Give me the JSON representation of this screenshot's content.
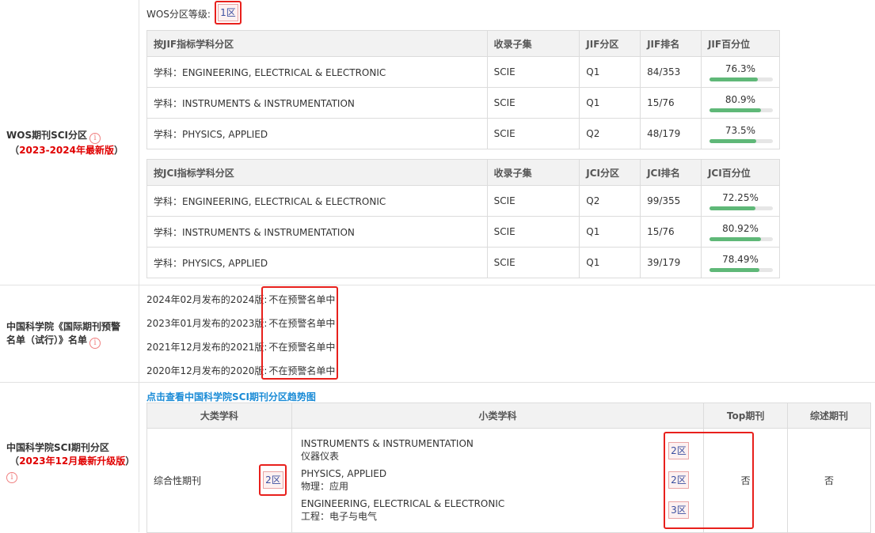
{
  "wos": {
    "grade_label": "WOS分区等级:",
    "grade_value": "1区",
    "section_label": "WOS期刊SCI分区",
    "section_note": "2023-2024年最新版",
    "jif_headers": [
      "按JIF指标学科分区",
      "收录子集",
      "JIF分区",
      "JIF排名",
      "JIF百分位"
    ],
    "jif_rows": [
      {
        "subject": "学科：ENGINEERING, ELECTRICAL & ELECTRONIC",
        "collection": "SCIE",
        "zone": "Q1",
        "rank": "84/353",
        "pct": "76.3%",
        "pct_value": 76.3
      },
      {
        "subject": "学科：INSTRUMENTS & INSTRUMENTATION",
        "collection": "SCIE",
        "zone": "Q1",
        "rank": "15/76",
        "pct": "80.9%",
        "pct_value": 80.9
      },
      {
        "subject": "学科：PHYSICS, APPLIED",
        "collection": "SCIE",
        "zone": "Q2",
        "rank": "48/179",
        "pct": "73.5%",
        "pct_value": 73.5
      }
    ],
    "jci_headers": [
      "按JCI指标学科分区",
      "收录子集",
      "JCI分区",
      "JCI排名",
      "JCI百分位"
    ],
    "jci_rows": [
      {
        "subject": "学科：ENGINEERING, ELECTRICAL & ELECTRONIC",
        "collection": "SCIE",
        "zone": "Q2",
        "rank": "99/355",
        "pct": "72.25%",
        "pct_value": 72.25
      },
      {
        "subject": "学科：INSTRUMENTS & INSTRUMENTATION",
        "collection": "SCIE",
        "zone": "Q1",
        "rank": "15/76",
        "pct": "80.92%",
        "pct_value": 80.92
      },
      {
        "subject": "学科：PHYSICS, APPLIED",
        "collection": "SCIE",
        "zone": "Q1",
        "rank": "39/179",
        "pct": "78.49%",
        "pct_value": 78.49
      }
    ]
  },
  "warning": {
    "section_label_line1": "中国科学院《国际期刊预警",
    "section_label_line2": "名单（试行）》名单",
    "rows": [
      {
        "label": "2024年02月发布的2024版:",
        "value": "不在预警名单中"
      },
      {
        "label": "2023年01月发布的2023版:",
        "value": "不在预警名单中"
      },
      {
        "label": "2021年12月发布的2021版:",
        "value": "不在预警名单中"
      },
      {
        "label": "2020年12月发布的2020版:",
        "value": "不在预警名单中"
      }
    ]
  },
  "cas": {
    "section_label": "中国科学院SCI期刊分区",
    "section_note": "2023年12月最新升级版",
    "trend_link": "点击查看中国科学院SCI期刊分区趋势图",
    "headers": [
      "大类学科",
      "小类学科",
      "Top期刊",
      "综述期刊"
    ],
    "major_subject": "综合性期刊",
    "major_zone": "2区",
    "sub_subjects": [
      {
        "en": "INSTRUMENTS & INSTRUMENTATION",
        "cn": "仪器仪表",
        "zone": "2区"
      },
      {
        "en": "PHYSICS, APPLIED",
        "cn": "物理：应用",
        "zone": "2区"
      },
      {
        "en": "ENGINEERING, ELECTRICAL & ELECTRONIC",
        "cn": "工程：电子与电气",
        "zone": "3区"
      }
    ],
    "top_journal": "否",
    "review_journal": "否"
  },
  "icons": {
    "info": "info-circle-icon"
  },
  "colors": {
    "highlight_border": "#e8201c",
    "bar_fill": "#5fb878",
    "link": "#1a8bd6",
    "note_red": "#e00000"
  }
}
